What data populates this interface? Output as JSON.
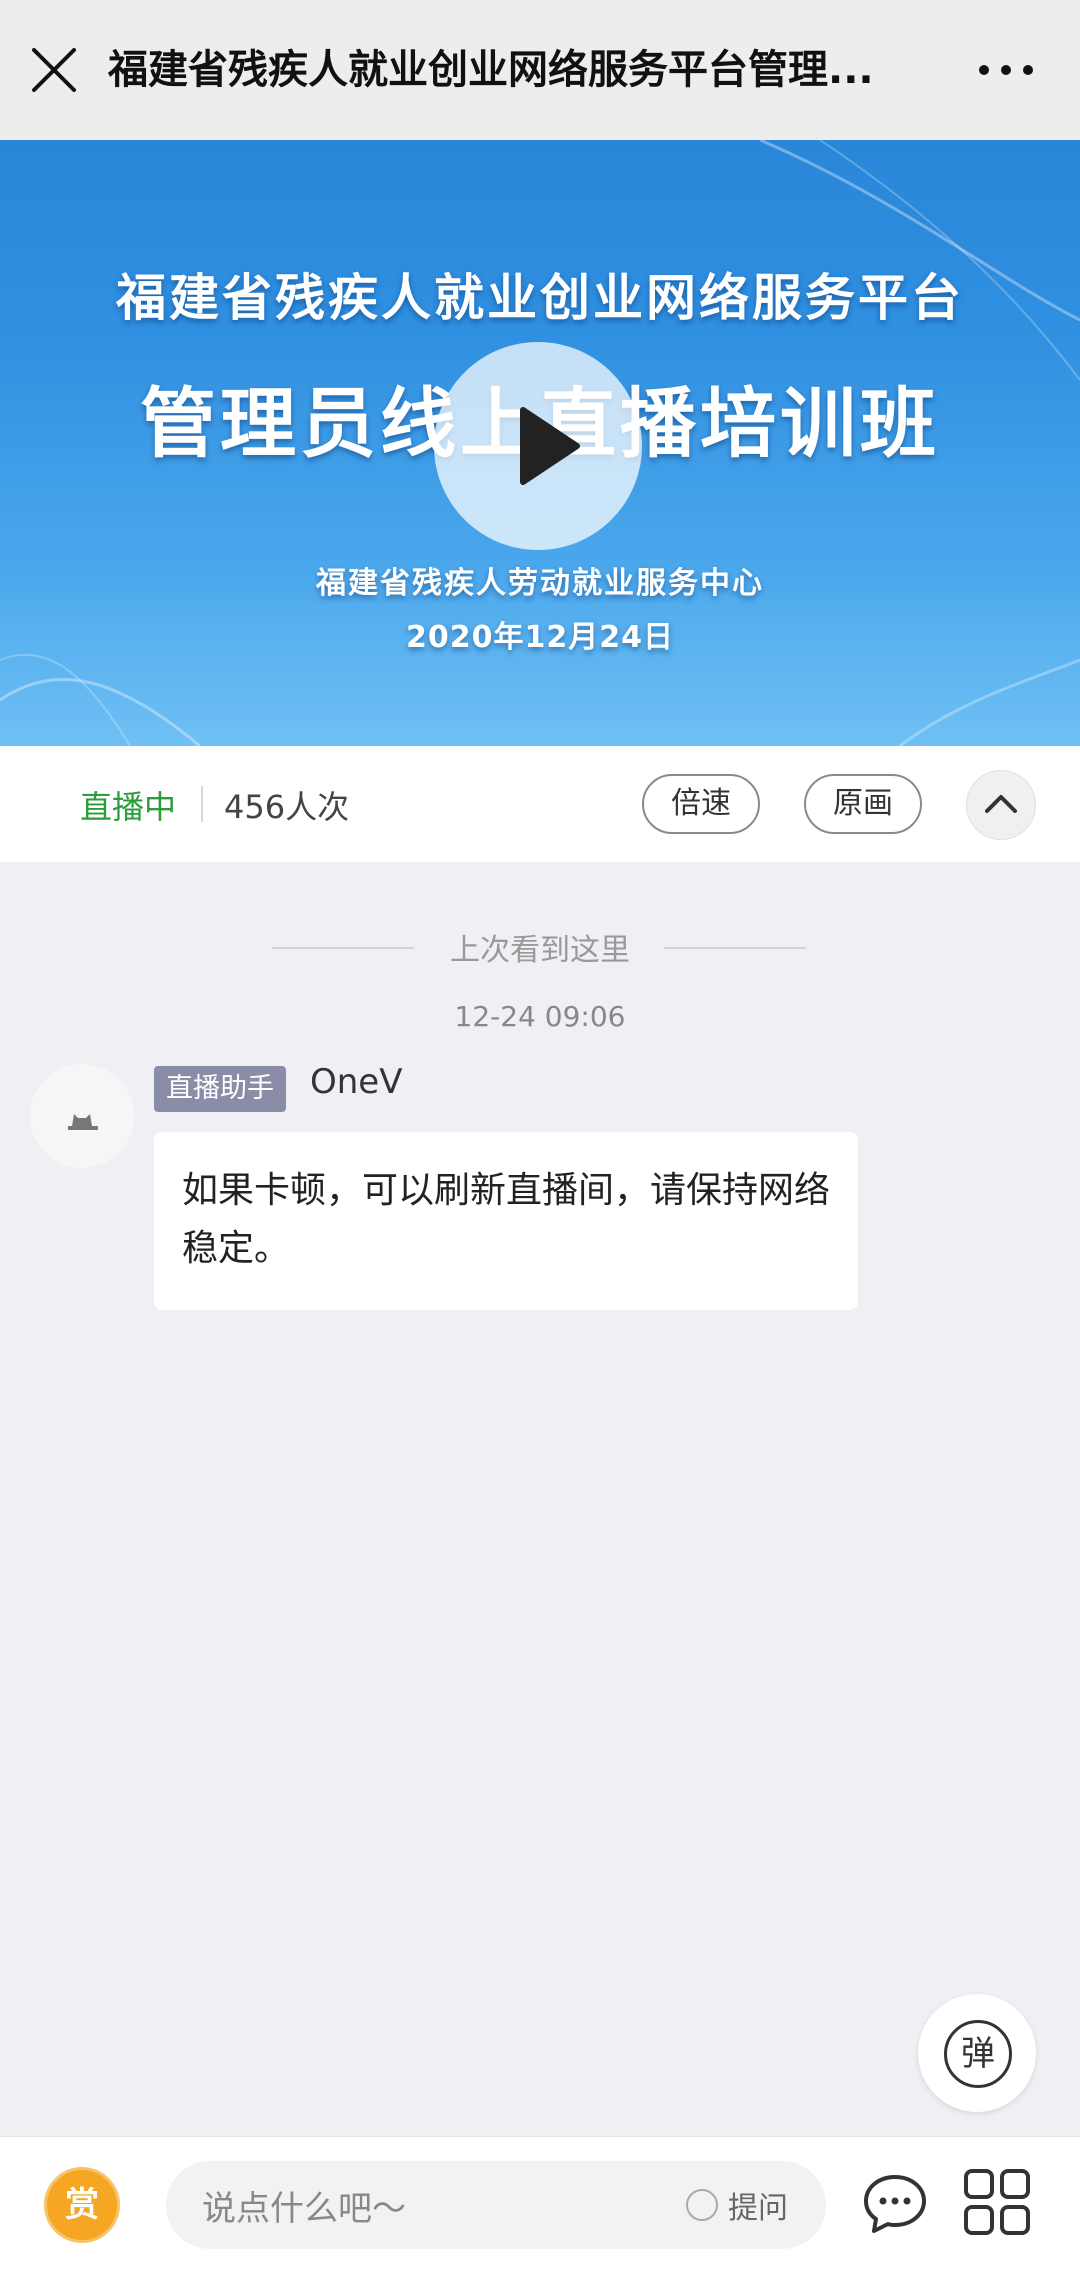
{
  "topbar": {
    "title": "福建省残疾人就业创业网络服务平台管理...",
    "close_icon": "close-icon",
    "more_icon": "more-icon"
  },
  "video": {
    "title_line1": "福建省残疾人就业创业网络服务平台",
    "title_line2": "管理员线上直播培训班",
    "organizer": "福建省残疾人劳动就业服务中心",
    "date": "2020年12月24日",
    "play_icon": "play-icon"
  },
  "status": {
    "live_label": "直播中",
    "viewers": "456人次",
    "speed_button": "倍速",
    "original_button": "原画",
    "collapse_icon": "chevron-up-icon"
  },
  "chat": {
    "last_seen": "上次看到这里",
    "timestamp": "12-24 09:06",
    "message": {
      "badge": "直播助手",
      "sender": "OneV",
      "text": "如果卡顿，可以刷新直播间，请保持网络稳定。"
    }
  },
  "danmaku": {
    "label": "弹"
  },
  "bottom": {
    "reward_label": "赏",
    "placeholder": "说点什么吧〜",
    "ask_label": "提问",
    "chat_icon": "chat-bubble-icon",
    "menu_icon": "grid-menu-icon"
  },
  "colors": {
    "live_green": "#2a9d3a",
    "reward_orange": "#f5a623",
    "badge_gray": "#8b8ca8",
    "video_blue": "#2f8fe0"
  }
}
